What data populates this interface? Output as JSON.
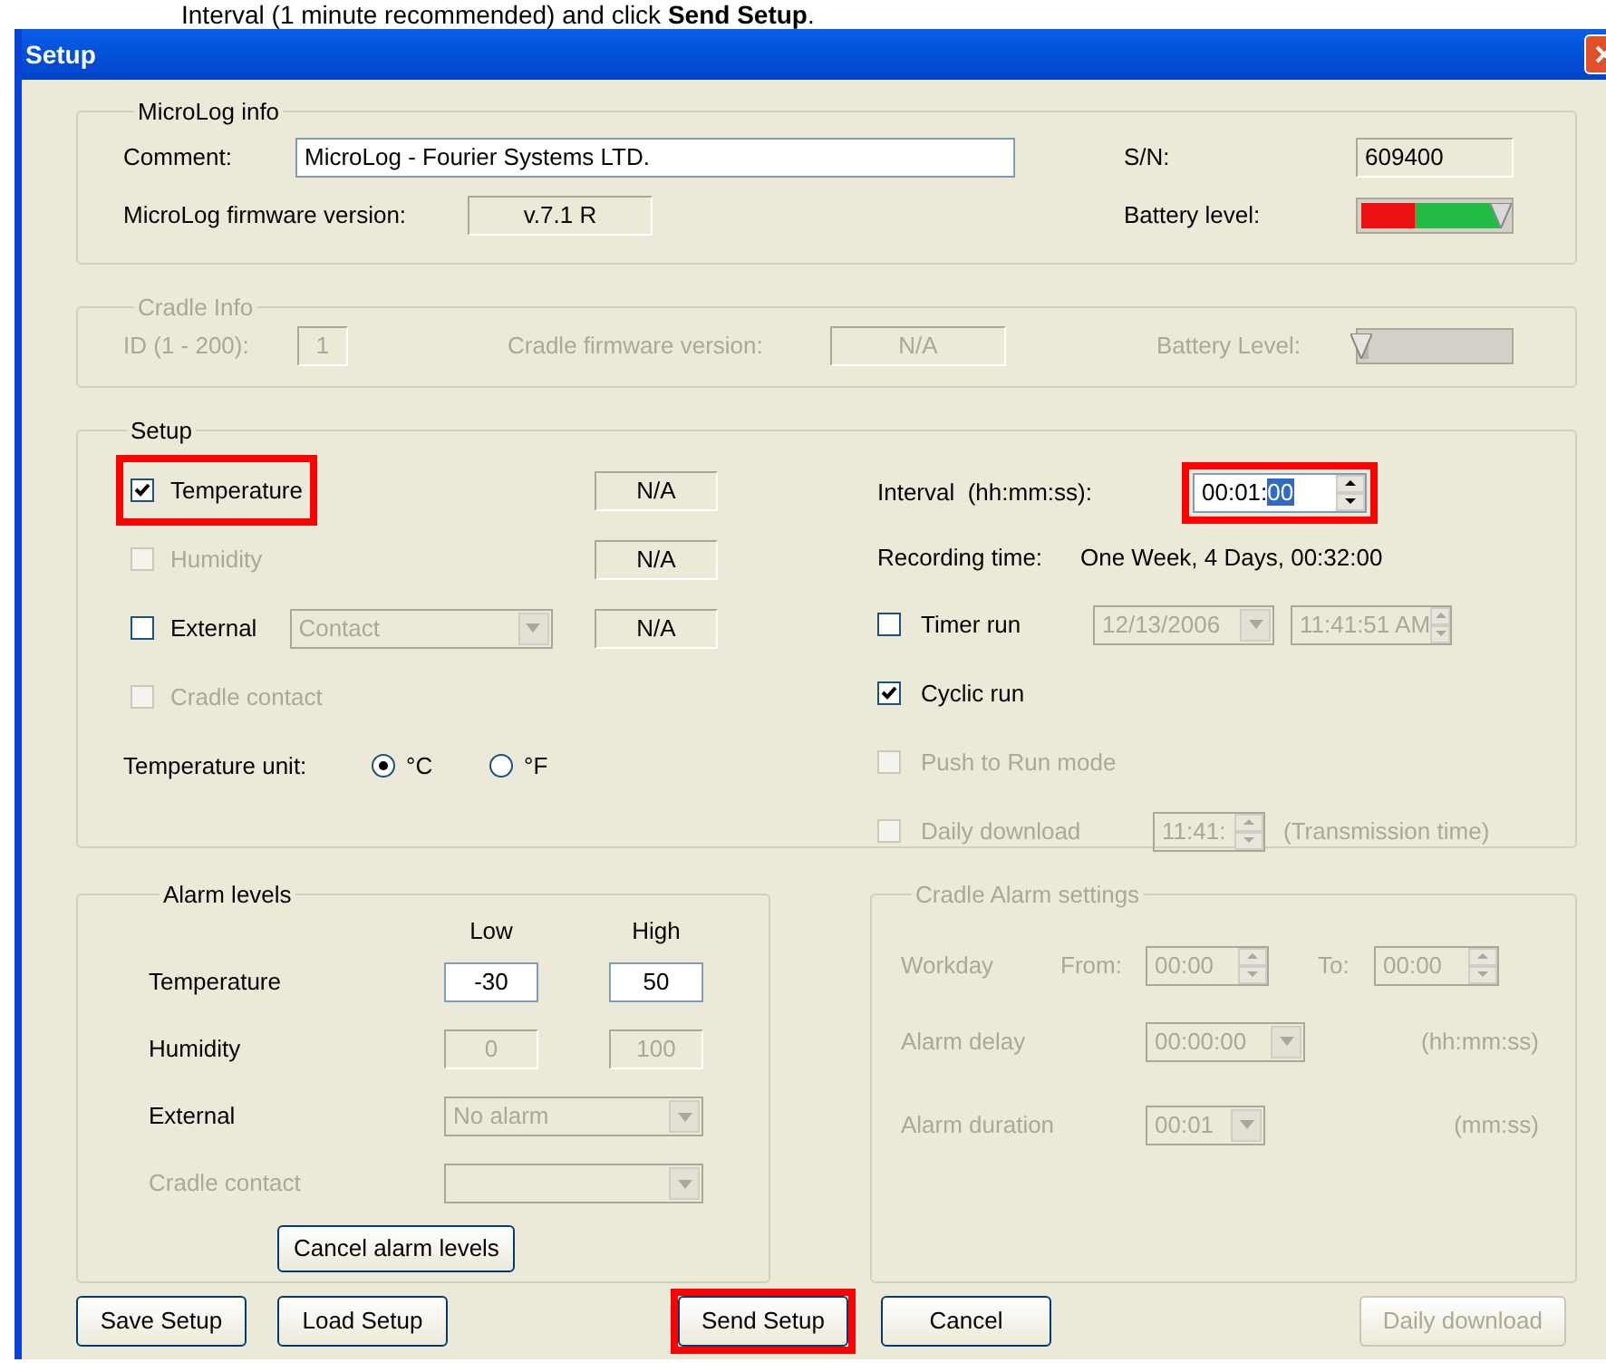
{
  "instruction": "Interval (1 minute recommended) and click **Send Setup**.",
  "window": {
    "title": "Setup"
  },
  "microlog_info": {
    "title": "MicroLog info",
    "comment_label": "Comment:",
    "comment_value": "MicroLog -  Fourier Systems LTD.",
    "sn_label": "S/N:",
    "sn_value": "609400",
    "firmware_label": "MicroLog firmware version:",
    "firmware_value": "v.7.1 R",
    "battery_label": "Battery level:",
    "battery": {
      "level": 0.95
    }
  },
  "cradle_info": {
    "title": "Cradle Info",
    "disabled": true,
    "id_label": "ID (1 - 200):",
    "id_value": "1",
    "firmware_label": "Cradle firmware version:",
    "firmware_value": "N/A",
    "battery_label": "Battery Level:",
    "battery": {
      "level": 0.05
    }
  },
  "setup": {
    "title": "Setup",
    "sensors": [
      {
        "kind": "plain",
        "label": "Temperature",
        "checked": true,
        "disabled": false,
        "highlighted": true,
        "reading": "N/A"
      },
      {
        "kind": "plain",
        "label": "Humidity",
        "checked": false,
        "disabled": true,
        "highlighted": false,
        "reading": "N/A"
      },
      {
        "kind": "select",
        "label": "External",
        "checked": false,
        "disabled": false,
        "highlighted": false,
        "select": "Contact",
        "reading": "N/A"
      },
      {
        "kind": "plain",
        "label": "Cradle contact",
        "checked": false,
        "disabled": true,
        "highlighted": false
      }
    ],
    "unit_label": "Temperature unit:",
    "units": [
      {
        "label": "°C",
        "selected": true
      },
      {
        "label": "°F",
        "selected": false
      }
    ],
    "interval_label": "Interval  (hh:mm:ss):",
    "interval_value": "00:01:",
    "interval_selection": "00",
    "interval_highlighted": true,
    "recording_label": "Recording time:",
    "recording_value": "One Week, 4 Days, 00:32:00",
    "options": [
      {
        "kind": "timer",
        "label": "Timer run",
        "checked": false,
        "disabled": false,
        "date": "12/13/2006",
        "time": "11:41:51 AM"
      },
      {
        "kind": "plain",
        "label": "Cyclic run",
        "checked": true,
        "disabled": false
      },
      {
        "kind": "plain",
        "label": "Push to Run mode",
        "checked": false,
        "disabled": true
      },
      {
        "kind": "daily",
        "label": "Daily download",
        "checked": false,
        "disabled": true,
        "time": "11:41:",
        "note": "(Transmission time)"
      }
    ]
  },
  "alarm_levels": {
    "title": "Alarm levels",
    "columns": [
      "Low",
      "High"
    ],
    "rows": [
      {
        "kind": "inputs",
        "label": "Temperature",
        "label_disabled": false,
        "disabled": false,
        "low": "-30",
        "high": "50"
      },
      {
        "kind": "inputs",
        "label": "Humidity",
        "label_disabled": false,
        "disabled": true,
        "low": "0",
        "high": "100"
      },
      {
        "kind": "select",
        "label": "External",
        "label_disabled": false,
        "disabled": true,
        "value": "No alarm"
      },
      {
        "kind": "select",
        "label": "Cradle contact",
        "label_disabled": true,
        "disabled": true
      }
    ],
    "button": "Cancel alarm levels"
  },
  "cradle_alarm": {
    "title": "Cradle Alarm settings",
    "disabled": true,
    "workday_label": "Workday",
    "from_label": "From:",
    "from": "00:00",
    "to_label": "To:",
    "to": "00:00",
    "rows": [
      {
        "label": "Alarm delay",
        "value": "00:00:00",
        "unit": "(hh:mm:ss)"
      },
      {
        "label": "Alarm duration",
        "value": "00:01",
        "unit": "(mm:ss)"
      }
    ]
  },
  "buttons": [
    {
      "label": "Save Setup",
      "disabled": false,
      "highlighted": false
    },
    {
      "label": "Load Setup",
      "disabled": false,
      "highlighted": false
    },
    {
      "label": "Send Setup",
      "disabled": false,
      "highlighted": true
    },
    {
      "label": "Cancel",
      "disabled": false,
      "highlighted": false
    },
    {
      "label": "Daily download",
      "disabled": true,
      "highlighted": false
    }
  ]
}
